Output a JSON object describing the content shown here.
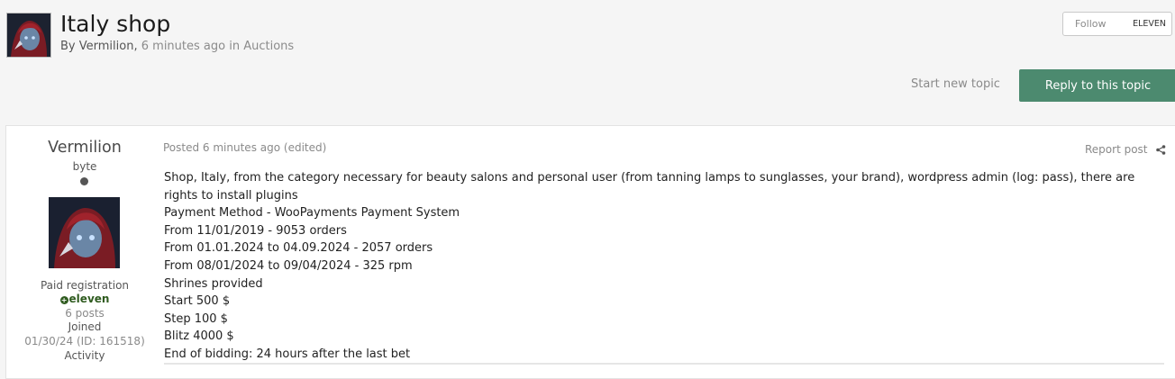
{
  "header": {
    "title": "Italy shop",
    "by": "By",
    "author": "Vermilion",
    "separator": ",",
    "time": "6 minutes ago",
    "in": "in",
    "forum": "Auctions"
  },
  "follow": {
    "label": "Follow",
    "count": "ELEVEN"
  },
  "actions": {
    "start_topic": "Start new topic",
    "reply": "Reply to this topic"
  },
  "post": {
    "author": {
      "name": "Vermilion",
      "rank": "byte",
      "registration": "Paid registration",
      "group": "eleven",
      "posts": "6 posts",
      "joined_label": "Joined",
      "joined": "01/30/24 (ID: 161518)",
      "activity_label": "Activity"
    },
    "meta": "Posted 6 minutes ago (edited)",
    "report": "Report post",
    "lines": [
      "Shop, Italy, from the category necessary for beauty salons and personal user (from tanning lamps to sunglasses, your brand), wordpress admin (log: pass), there are rights to install plugins",
      "Payment Method - WooPayments Payment System",
      "From 11/01/2019 - 9053 orders",
      "From 01.01.2024 to 04.09.2024 - 2057 orders",
      "From 08/01/2024 to 09/04/2024 - 325 rpm",
      "Shrines provided",
      "Start 500 $",
      "Step 100 $",
      "Blitz 4000 $",
      "End of bidding: 24 hours after the last bet"
    ]
  },
  "colors": {
    "accent": "#4c8a6f",
    "group": "#2f5b1f"
  },
  "icons": {
    "share": "share-icon",
    "rank": "rank-dot-icon"
  }
}
